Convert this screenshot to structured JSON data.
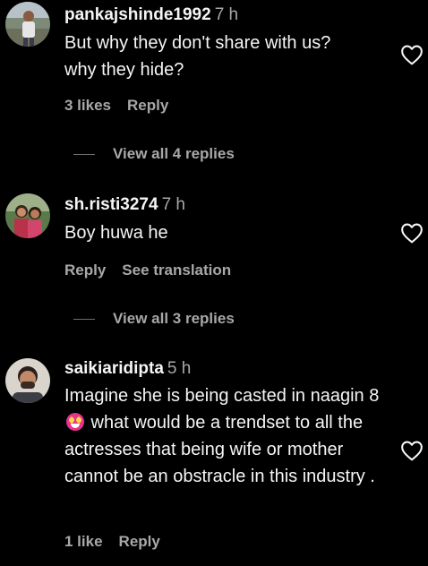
{
  "comments": [
    {
      "username": "pankajshinde1992",
      "time": "7 h",
      "text_line1": "But why they don't share with us?",
      "text_line2": "why they hide?",
      "likes": "3 likes",
      "reply": "Reply",
      "view_replies": "View all 4 replies"
    },
    {
      "username": "sh.risti3274",
      "time": "7 h",
      "text": "Boy huwa he",
      "reply": "Reply",
      "see_translation": "See translation",
      "view_replies": "View all 3 replies"
    },
    {
      "username": "saikiaridipta",
      "time": "5 h",
      "text_before_emoji": "Imagine she is being casted in naagin 8",
      "text_after_emoji": " what would be a trendset to all the actresses that being wife or mother cannot be an obstracle in this industry .",
      "likes": "1 like",
      "reply": "Reply"
    }
  ],
  "icons": {
    "like": "heart-outline-icon",
    "emoji": "star-struck-emoji-icon"
  },
  "colors": {
    "background": "#000000",
    "primary_text": "#f5f5f5",
    "secondary_text": "#a8a8a8"
  }
}
